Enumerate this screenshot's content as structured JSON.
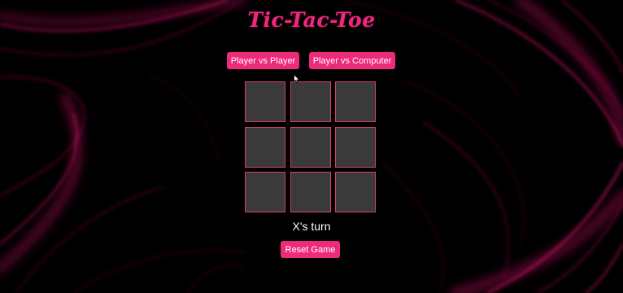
{
  "title": "Tic-Tac-Toe",
  "modes": {
    "pvp_label": "Player vs Player",
    "pvc_label": "Player vs Computer"
  },
  "board": {
    "cells": [
      "",
      "",
      "",
      "",
      "",
      "",
      "",
      "",
      ""
    ]
  },
  "status_text": "X's turn",
  "reset_label": "Reset Game",
  "colors": {
    "accent": "#ee2a7b",
    "cell_bg": "#3a3a3a",
    "cell_border": "#d83a78",
    "background": "#000000"
  }
}
